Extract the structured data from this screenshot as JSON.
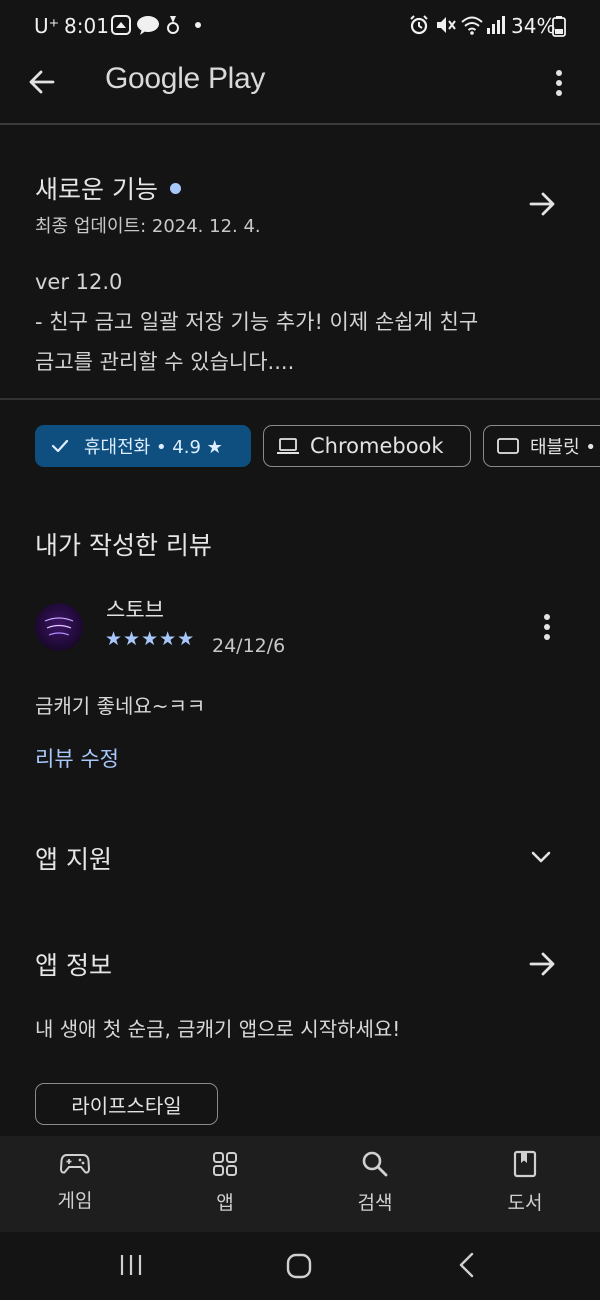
{
  "status_bar": {
    "carrier": "U⁺",
    "time": "8:01",
    "battery": "34%"
  },
  "app_bar": {
    "title": "Google Play"
  },
  "whats_new": {
    "title": "새로운 기능",
    "last_updated": "최종 업데이트: 2024. 12. 4.",
    "version": "ver 12.0",
    "notes_line1": "- 친구 금고 일괄 저장 기능 추가! 이제 손쉽게 친구",
    "notes_line2": "금고를 관리할 수 있습니다...."
  },
  "device_chips": [
    {
      "label": "휴대전화 • 4.9 ★",
      "selected": true
    },
    {
      "label": "Chromebook",
      "selected": false
    },
    {
      "label": "태블릿 •",
      "selected": false
    }
  ],
  "my_review": {
    "section_title": "내가 작성한 리뷰",
    "author": "스토브",
    "stars": "★★★★★",
    "rating": 5,
    "date": "24/12/6",
    "text": "금캐기 좋네요~ㅋㅋ",
    "edit_label": "리뷰 수정"
  },
  "app_support": {
    "title": "앱 지원"
  },
  "app_info": {
    "title": "앱 정보",
    "description": "내 생애 첫 순금, 금캐기 앱으로 시작하세요!",
    "tag": "라이프스타일"
  },
  "bottom_nav": [
    {
      "label": "게임",
      "icon": "gamepad-icon"
    },
    {
      "label": "앱",
      "icon": "apps-grid-icon"
    },
    {
      "label": "검색",
      "icon": "search-icon"
    },
    {
      "label": "도서",
      "icon": "book-icon"
    }
  ],
  "colors": {
    "background": "#141414",
    "accent_blue": "#a8c7fa",
    "chip_selected": "#0e4f7f",
    "dot": "#a8c7fa"
  }
}
